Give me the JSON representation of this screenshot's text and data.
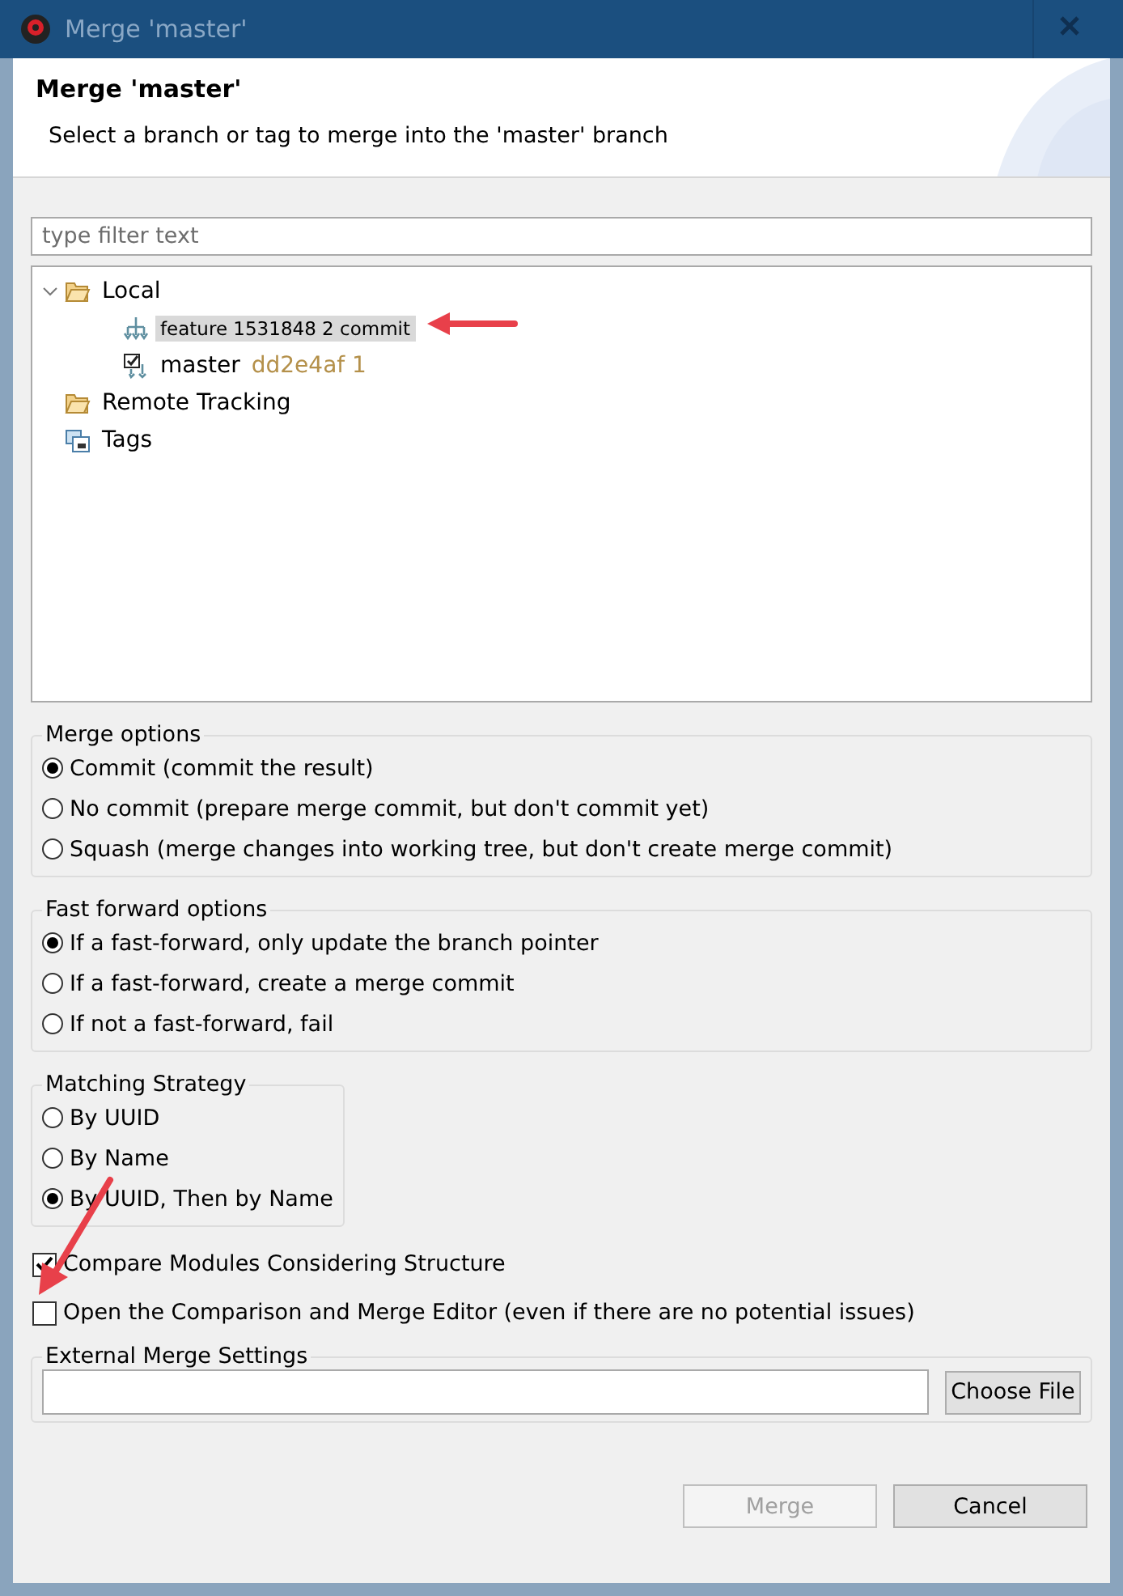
{
  "window": {
    "title": "Merge 'master'"
  },
  "header": {
    "title": "Merge 'master'",
    "description": "Select a branch or tag to merge into the 'master' branch"
  },
  "filter": {
    "placeholder": "type filter text"
  },
  "tree": [
    {
      "kind": "folder",
      "label": "Local",
      "selected": false,
      "children": [
        {
          "kind": "branch",
          "label": "feature 1531848 2 commit",
          "selected": true
        },
        {
          "kind": "checked-branch",
          "label": "master",
          "detail": "dd2e4af 1",
          "selected": false
        }
      ]
    },
    {
      "kind": "folder",
      "label": "Remote Tracking",
      "selected": false
    },
    {
      "kind": "tags",
      "label": "Tags",
      "selected": false
    }
  ],
  "merge_options": {
    "title": "Merge options",
    "options": [
      {
        "label": "Commit (commit the result)",
        "selected": true
      },
      {
        "label": "No commit (prepare merge commit, but don't commit yet)",
        "selected": false
      },
      {
        "label": "Squash (merge changes into working tree, but don't create merge commit)",
        "selected": false
      }
    ]
  },
  "fast_forward_options": {
    "title": "Fast forward options",
    "options": [
      {
        "label": "If a fast-forward, only update the branch pointer",
        "selected": true
      },
      {
        "label": "If a fast-forward, create a merge commit",
        "selected": false
      },
      {
        "label": "If not a fast-forward, fail",
        "selected": false
      }
    ]
  },
  "matching_strategy": {
    "title": "Matching Strategy",
    "options": [
      {
        "label": "By UUID",
        "selected": false
      },
      {
        "label": "By Name",
        "selected": false
      },
      {
        "label": "By UUID, Then by Name",
        "selected": true
      }
    ]
  },
  "checkboxes": [
    {
      "label": "Compare Modules Considering Structure",
      "checked": true
    },
    {
      "label": "Open the Comparison and Merge Editor (even if there are no potential issues)",
      "checked": false
    }
  ],
  "external_merge": {
    "title": "External Merge Settings",
    "button": "Choose File"
  },
  "buttons": [
    {
      "label": "Merge",
      "disabled": true
    },
    {
      "label": "Cancel",
      "disabled": false
    }
  ]
}
